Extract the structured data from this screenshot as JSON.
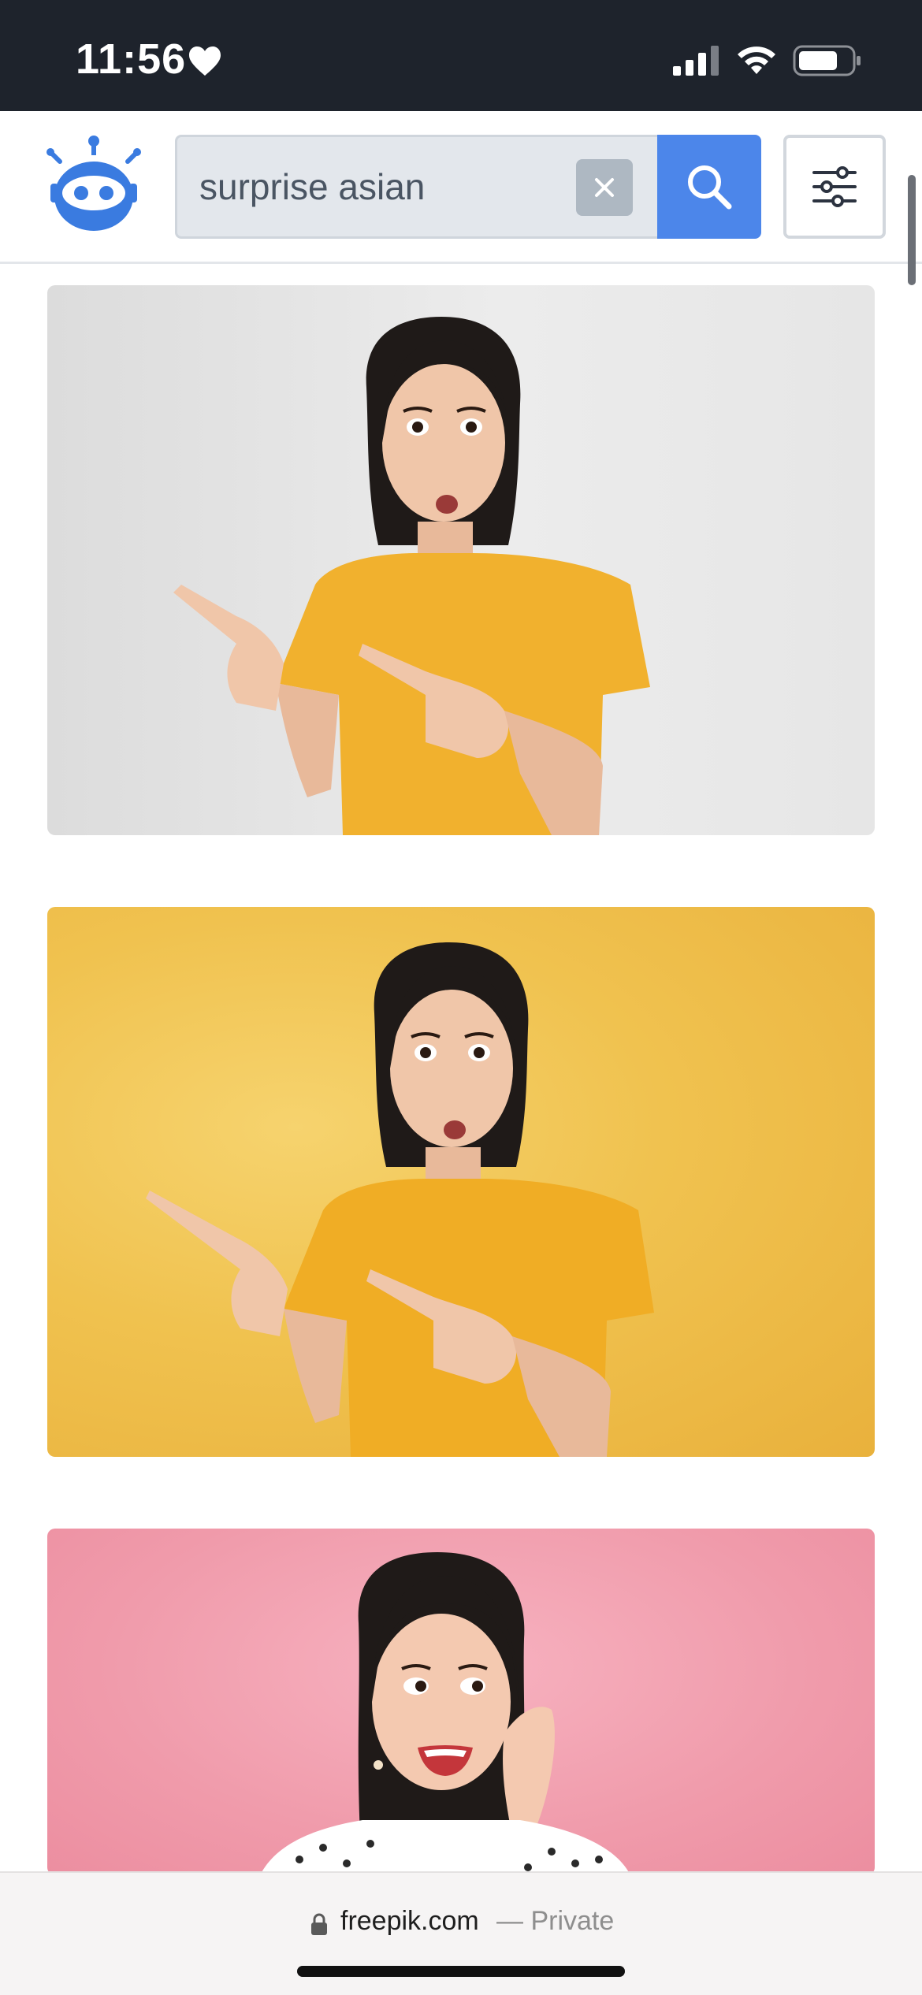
{
  "status_bar": {
    "time": "11:56",
    "heart_icon": "heart-icon",
    "signal_icon": "cellular-signal-icon",
    "wifi_icon": "wifi-icon",
    "battery_icon": "battery-icon",
    "battery_level": 0.7
  },
  "header": {
    "logo_icon": "robot-logo-icon",
    "search": {
      "value": "surprise asian",
      "placeholder": ""
    },
    "clear_icon": "close-icon",
    "search_icon": "search-icon",
    "filter_icon": "sliders-icon"
  },
  "results": [
    {
      "background": "light gray",
      "shirt_color": "#f1b12e"
    },
    {
      "background": "yellow",
      "shirt_color": "#f1b12e"
    },
    {
      "background": "pink",
      "shirt_color": "#ffffff"
    }
  ],
  "url_bar": {
    "lock_icon": "lock-icon",
    "domain": "freepik.com",
    "mode": "— Private"
  },
  "colors": {
    "status_bg": "#1e232c",
    "accent": "#4c86ea",
    "search_bg": "#e3e7ec"
  }
}
